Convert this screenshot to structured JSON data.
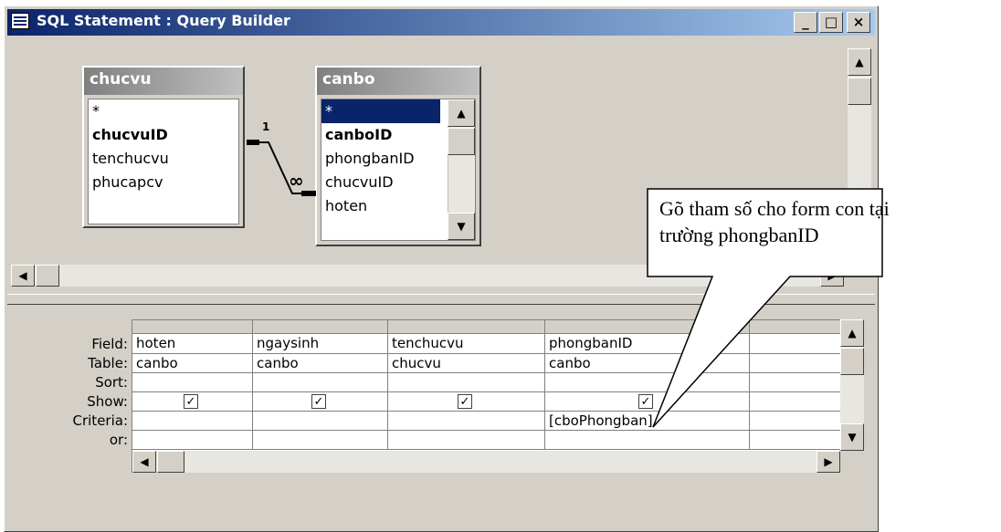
{
  "window": {
    "title": "SQL Statement : Query Builder",
    "controls": {
      "minimize": "_",
      "maximize": "□",
      "close": "×"
    }
  },
  "tables": [
    {
      "name": "chucvu",
      "fields": [
        "*",
        "chucvuID",
        "tenchucvu",
        "phucapcv"
      ],
      "key": "chucvuID"
    },
    {
      "name": "canbo",
      "fields": [
        "*",
        "canboID",
        "phongbanID",
        "chucvuID",
        "hoten"
      ],
      "key": "canboID",
      "selected": "*"
    }
  ],
  "relationship": {
    "one": "1",
    "many": "∞"
  },
  "grid": {
    "row_labels": [
      "Field:",
      "Table:",
      "Sort:",
      "Show:",
      "Criteria:",
      "or:"
    ],
    "columns": [
      {
        "field": "hoten",
        "table": "canbo",
        "sort": "",
        "show": true,
        "criteria": "",
        "or": ""
      },
      {
        "field": "ngaysinh",
        "table": "canbo",
        "sort": "",
        "show": true,
        "criteria": "",
        "or": ""
      },
      {
        "field": "tenchucvu",
        "table": "chucvu",
        "sort": "",
        "show": true,
        "criteria": "",
        "or": ""
      },
      {
        "field": "phongbanID",
        "table": "canbo",
        "sort": "",
        "show": true,
        "criteria": "[cboPhongban]",
        "or": ""
      }
    ]
  },
  "callout": {
    "line1": "Gõ tham số cho form con tại",
    "line2": "trường phongbanID"
  },
  "icons": [
    "app-icon",
    "scroll-up-icon",
    "scroll-down-icon",
    "scroll-left-icon",
    "scroll-right-icon",
    "checkbox-checked-icon"
  ]
}
